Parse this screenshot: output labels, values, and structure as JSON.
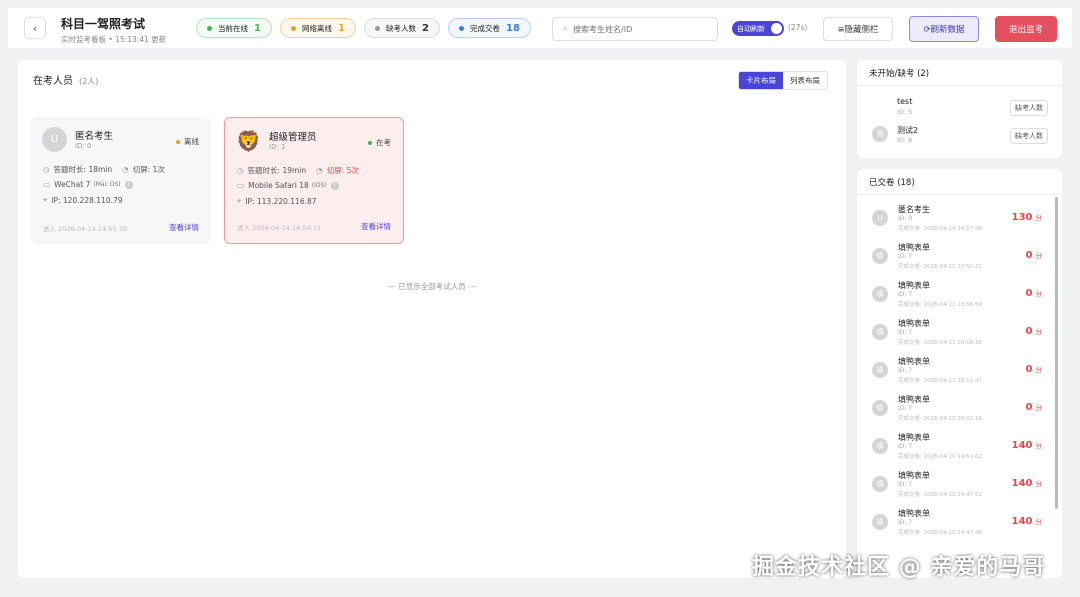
{
  "header": {
    "back_icon": "chevron-left",
    "title": "科目一驾照考试",
    "subtitle": "实时监考看板 • 15:13:41 更新",
    "stats": [
      {
        "label": "当前在线",
        "value": "1",
        "color": "#3fb950"
      },
      {
        "label": "网络离线",
        "value": "1",
        "color": "#f0a020"
      },
      {
        "label": "缺考人数",
        "value": "2",
        "color": "#999999"
      },
      {
        "label": "完成交卷",
        "value": "18",
        "color": "#3b7bd8"
      }
    ],
    "search_placeholder": "搜索考生姓名/ID",
    "auto_refresh_label": "自动刷新",
    "countdown": "(27s)",
    "hide_sidebar_label": "≡隐藏侧栏",
    "refresh_label": "⟳刷新数据",
    "exit_label": "退出监考"
  },
  "main": {
    "title": "在考人员",
    "count": "(2人)",
    "layout_card": "卡片布局",
    "layout_list": "列表布局",
    "end_note": "--- 已显示全部考试人员 ---",
    "cards": [
      {
        "avatar": "U",
        "name": "匿名考生",
        "id": "ID: 0",
        "status": "离线",
        "duration": "答题时长: 18min",
        "switches": "切屏: 1次",
        "device": "WeChat 7",
        "os": "(Mac OS)",
        "ip": "IP: 120.228.110.79",
        "enter": "进入  2026-04-14 14:55:39",
        "link": "查看详情"
      },
      {
        "avatar": "🦁",
        "name": "超级管理员",
        "id": "ID: 1",
        "status": "在考",
        "duration": "答题时长: 19min",
        "switches": "切屏: 5次",
        "device": "Mobile Safari 18",
        "os": "(iOS)",
        "ip": "IP: 113.220.116.87",
        "enter": "进入  2026-04-14 14:54:11",
        "link": "查看详情"
      }
    ]
  },
  "absent": {
    "title": "未开始/缺考 (2)",
    "items": [
      {
        "avatar": "",
        "name": "test",
        "id": "ID: 5",
        "badge": "缺考人数"
      },
      {
        "avatar": "测",
        "name": "测试2",
        "id": "ID: 6",
        "badge": "缺考人数"
      }
    ]
  },
  "submitted": {
    "title": "已交卷 (18)",
    "unit": "分",
    "items": [
      {
        "avatar": "U",
        "name": "匿名考生",
        "id": "ID: 0",
        "time": "完成交卷: 2026-04-14 14:57:58",
        "score": "130"
      },
      {
        "avatar": "填",
        "name": "填鸭表单",
        "id": "ID: 7",
        "time": "完成交卷: 2026-04-11 22:52:22",
        "score": "0"
      },
      {
        "avatar": "填",
        "name": "填鸭表单",
        "id": "ID: 7",
        "time": "完成交卷: 2026-04-11 21:56:59",
        "score": "0"
      },
      {
        "avatar": "填",
        "name": "填鸭表单",
        "id": "ID: 7",
        "time": "完成交卷: 2026-04-11 20:16:36",
        "score": "0"
      },
      {
        "avatar": "填",
        "name": "填鸭表单",
        "id": "ID: 7",
        "time": "完成交卷: 2026-04-11 18:11:47",
        "score": "0"
      },
      {
        "avatar": "填",
        "name": "填鸭表单",
        "id": "ID: 7",
        "time": "完成交卷: 2026-04-10 16:02:16",
        "score": "0"
      },
      {
        "avatar": "填",
        "name": "填鸭表单",
        "id": "ID: 7",
        "time": "完成交卷: 2026-04-10 14:53:02",
        "score": "140"
      },
      {
        "avatar": "填",
        "name": "填鸭表单",
        "id": "ID: 7",
        "time": "完成交卷: 2026-04-10 14:47:52",
        "score": "140"
      },
      {
        "avatar": "填",
        "name": "填鸭表单",
        "id": "ID: 7",
        "time": "完成交卷: 2026-04-10 14:47:48",
        "score": "140"
      }
    ]
  },
  "watermark": "掘金技术社区 @ 亲爱的马哥"
}
